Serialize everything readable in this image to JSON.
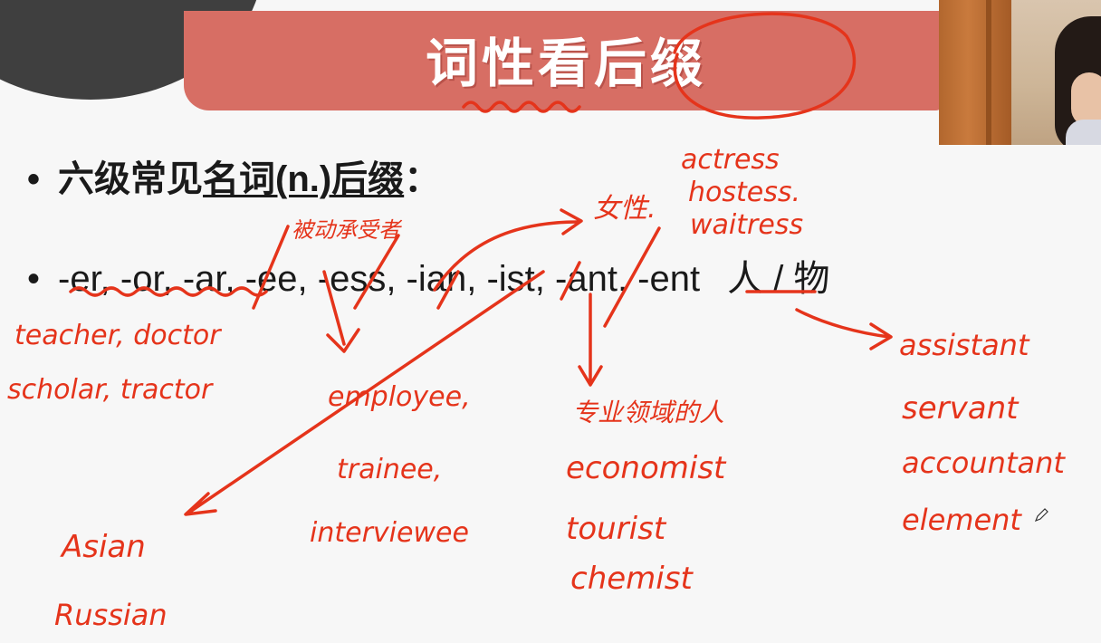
{
  "slide": {
    "title": "词性看后缀",
    "bullet1_prefix": "六级常见",
    "bullet1_underlined": "名词(n.)后缀",
    "bullet1_suffix": "：",
    "bullet2_suffixes": "-er, -or, -ar, -ee, -ess, -ian, -ist, -ant, -ent",
    "bullet2_meaning": "人 / 物"
  },
  "annotations": {
    "passive_note": "被动承受者",
    "female_note": "女性.",
    "profession_note": "专业领域的人",
    "er_examples_1": "teacher, doctor",
    "er_examples_2": "scholar, tractor",
    "ee_examples_1": "employee,",
    "ee_examples_2": "trainee,",
    "ee_examples_3": "interviewee",
    "ess_examples_1": "actress",
    "ess_examples_2": "hostess.",
    "ess_examples_3": "waitress",
    "ian_examples_1": "Asian",
    "ian_examples_2": "Russian",
    "ist_examples_1": "economist",
    "ist_examples_2": "tourist",
    "ist_examples_3": "chemist",
    "ant_examples_1": "assistant",
    "ant_examples_2": "servant",
    "ant_examples_3": "accountant",
    "ant_examples_4": "element"
  },
  "colors": {
    "banner": "#d76e64",
    "ink": "#e5341b",
    "text": "#1a1a1a",
    "background": "#f7f7f7"
  },
  "icons": {
    "pen": "pen-cursor-icon"
  }
}
